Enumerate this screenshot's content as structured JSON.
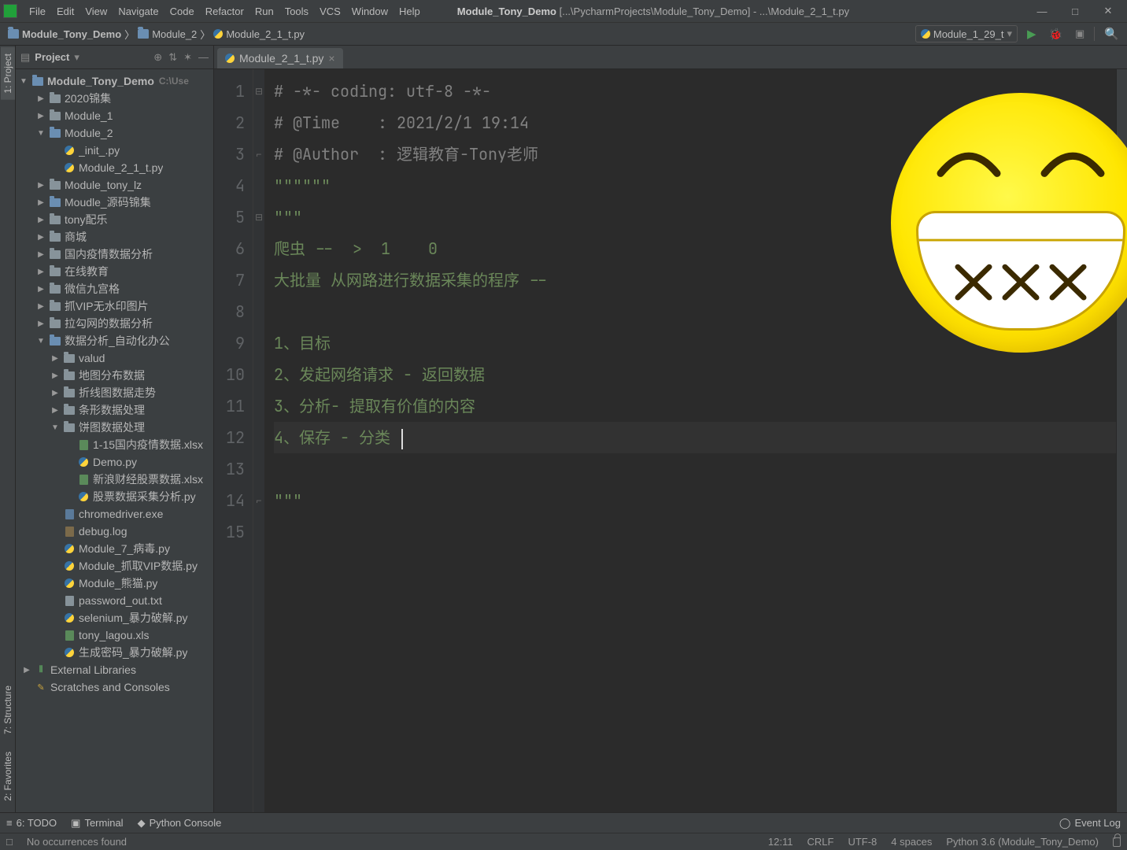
{
  "window": {
    "title_prefix": "Module_Tony_Demo",
    "title_path": "[...\\PycharmProjects\\Module_Tony_Demo] - ...\\Module_2_1_t.py"
  },
  "menu": [
    "File",
    "Edit",
    "View",
    "Navigate",
    "Code",
    "Refactor",
    "Run",
    "Tools",
    "VCS",
    "Window",
    "Help"
  ],
  "breadcrumbs": [
    {
      "icon": "folder",
      "label": "Module_Tony_Demo"
    },
    {
      "icon": "folder",
      "label": "Module_2"
    },
    {
      "icon": "python",
      "label": "Module_2_1_t.py"
    }
  ],
  "run_config": {
    "label": "Module_1_29_t"
  },
  "project_panel": {
    "title": "Project",
    "root": {
      "label": "Module_Tony_Demo",
      "suffix": "C:\\Use"
    },
    "tree": [
      {
        "d": 1,
        "exp": "▶",
        "ic": "folder",
        "label": "2020锦集"
      },
      {
        "d": 1,
        "exp": "▶",
        "ic": "folder",
        "label": "Module_1"
      },
      {
        "d": 1,
        "exp": "▼",
        "ic": "folder-blue",
        "label": "Module_2"
      },
      {
        "d": 2,
        "exp": "",
        "ic": "python",
        "label": "_init_.py"
      },
      {
        "d": 2,
        "exp": "",
        "ic": "python",
        "label": "Module_2_1_t.py"
      },
      {
        "d": 1,
        "exp": "▶",
        "ic": "folder",
        "label": "Module_tony_lz"
      },
      {
        "d": 1,
        "exp": "▶",
        "ic": "folder-blue",
        "label": "Moudle_源码锦集"
      },
      {
        "d": 1,
        "exp": "▶",
        "ic": "folder",
        "label": "tony配乐"
      },
      {
        "d": 1,
        "exp": "▶",
        "ic": "folder",
        "label": "商城"
      },
      {
        "d": 1,
        "exp": "▶",
        "ic": "folder",
        "label": "国内疫情数据分析"
      },
      {
        "d": 1,
        "exp": "▶",
        "ic": "folder",
        "label": "在线教育"
      },
      {
        "d": 1,
        "exp": "▶",
        "ic": "folder",
        "label": "微信九宫格"
      },
      {
        "d": 1,
        "exp": "▶",
        "ic": "folder",
        "label": "抓VIP无水印图片"
      },
      {
        "d": 1,
        "exp": "▶",
        "ic": "folder",
        "label": "拉勾网的数据分析"
      },
      {
        "d": 1,
        "exp": "▼",
        "ic": "folder-blue",
        "label": "数据分析_自动化办公"
      },
      {
        "d": 2,
        "exp": "▶",
        "ic": "folder",
        "label": "valud"
      },
      {
        "d": 2,
        "exp": "▶",
        "ic": "folder",
        "label": "地图分布数据"
      },
      {
        "d": 2,
        "exp": "▶",
        "ic": "folder",
        "label": "折线图数据走势"
      },
      {
        "d": 2,
        "exp": "▶",
        "ic": "folder",
        "label": "条形数据处理"
      },
      {
        "d": 2,
        "exp": "▼",
        "ic": "folder",
        "label": "饼图数据处理"
      },
      {
        "d": 3,
        "exp": "",
        "ic": "xls",
        "label": "1-15国内疫情数据.xlsx"
      },
      {
        "d": 3,
        "exp": "",
        "ic": "python",
        "label": "Demo.py"
      },
      {
        "d": 3,
        "exp": "",
        "ic": "xls",
        "label": "新浪财经股票数据.xlsx"
      },
      {
        "d": 3,
        "exp": "",
        "ic": "python",
        "label": "股票数据采集分析.py"
      },
      {
        "d": 2,
        "exp": "",
        "ic": "exe",
        "label": "chromedriver.exe"
      },
      {
        "d": 2,
        "exp": "",
        "ic": "log",
        "label": "debug.log"
      },
      {
        "d": 2,
        "exp": "",
        "ic": "python",
        "label": "Module_7_病毒.py"
      },
      {
        "d": 2,
        "exp": "",
        "ic": "python",
        "label": "Module_抓取VIP数据.py"
      },
      {
        "d": 2,
        "exp": "",
        "ic": "python",
        "label": "Module_熊猫.py"
      },
      {
        "d": 2,
        "exp": "",
        "ic": "txt",
        "label": "password_out.txt"
      },
      {
        "d": 2,
        "exp": "",
        "ic": "python",
        "label": "selenium_暴力破解.py"
      },
      {
        "d": 2,
        "exp": "",
        "ic": "xls",
        "label": "tony_lagou.xls"
      },
      {
        "d": 2,
        "exp": "",
        "ic": "python",
        "label": "生成密码_暴力破解.py"
      },
      {
        "d": 0,
        "exp": "▶",
        "ic": "lib",
        "label": "External Libraries"
      },
      {
        "d": 0,
        "exp": "",
        "ic": "scratch",
        "label": "Scratches and Consoles"
      }
    ]
  },
  "left_rail": {
    "project": "1: Project",
    "structure": "7: Structure",
    "favorites": "2: Favorites"
  },
  "editor": {
    "tab_label": "Module_2_1_t.py",
    "lines": [
      {
        "n": 1,
        "type": "comment",
        "text": "# -*- coding: utf-8 -*-"
      },
      {
        "n": 2,
        "type": "comment",
        "text": "# @Time    : 2021/2/1 19:14"
      },
      {
        "n": 3,
        "type": "comment",
        "text": "# @Author  : 逻辑教育-Tony老师"
      },
      {
        "n": 4,
        "type": "string",
        "text": "\"\"\"\"\"\""
      },
      {
        "n": 5,
        "type": "string",
        "text": "\"\"\""
      },
      {
        "n": 6,
        "type": "string",
        "text": "爬虫 --  >  1    0"
      },
      {
        "n": 7,
        "type": "string",
        "text": "大批量 从网路进行数据采集的程序 -- "
      },
      {
        "n": 8,
        "type": "string",
        "text": ""
      },
      {
        "n": 9,
        "type": "string",
        "text": "1、目标"
      },
      {
        "n": 10,
        "type": "string",
        "text": "2、发起网络请求 - 返回数据"
      },
      {
        "n": 11,
        "type": "string",
        "text": "3、分析- 提取有价值的内容"
      },
      {
        "n": 12,
        "type": "string",
        "text": "4、保存 - 分类 ",
        "current": true
      },
      {
        "n": 13,
        "type": "string",
        "text": ""
      },
      {
        "n": 14,
        "type": "string",
        "text": "\"\"\""
      },
      {
        "n": 15,
        "type": "plain",
        "text": ""
      }
    ]
  },
  "bottom_tools": {
    "todo": "6: TODO",
    "terminal": "Terminal",
    "python_console": "Python Console",
    "event_log": "Event Log"
  },
  "status": {
    "left": "No occurrences found",
    "pos": "12:11",
    "eol": "CRLF",
    "enc": "UTF-8",
    "indent": "4 spaces",
    "interpreter": "Python 3.6 (Module_Tony_Demo)"
  }
}
